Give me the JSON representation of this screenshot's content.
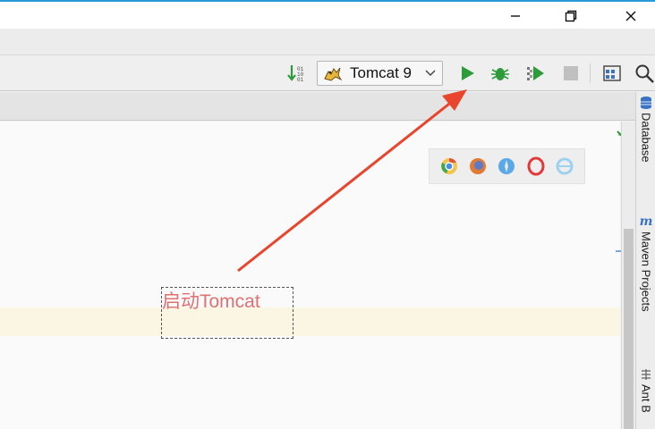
{
  "toolbar": {
    "run_config_name": "Tomcat 9"
  },
  "right_panel": {
    "tabs": [
      {
        "label": "Database"
      },
      {
        "label": "Maven Projects"
      },
      {
        "label": "Ant B"
      }
    ]
  },
  "annotation": {
    "text": "启动Tomcat",
    "arrow_color": "#e8452c"
  },
  "colors": {
    "run_green": "#2e9b3a",
    "highlight_line": "#fbf5e3"
  },
  "browsers": [
    "chrome-icon",
    "firefox-icon",
    "safari-icon",
    "opera-icon",
    "ie-icon"
  ]
}
